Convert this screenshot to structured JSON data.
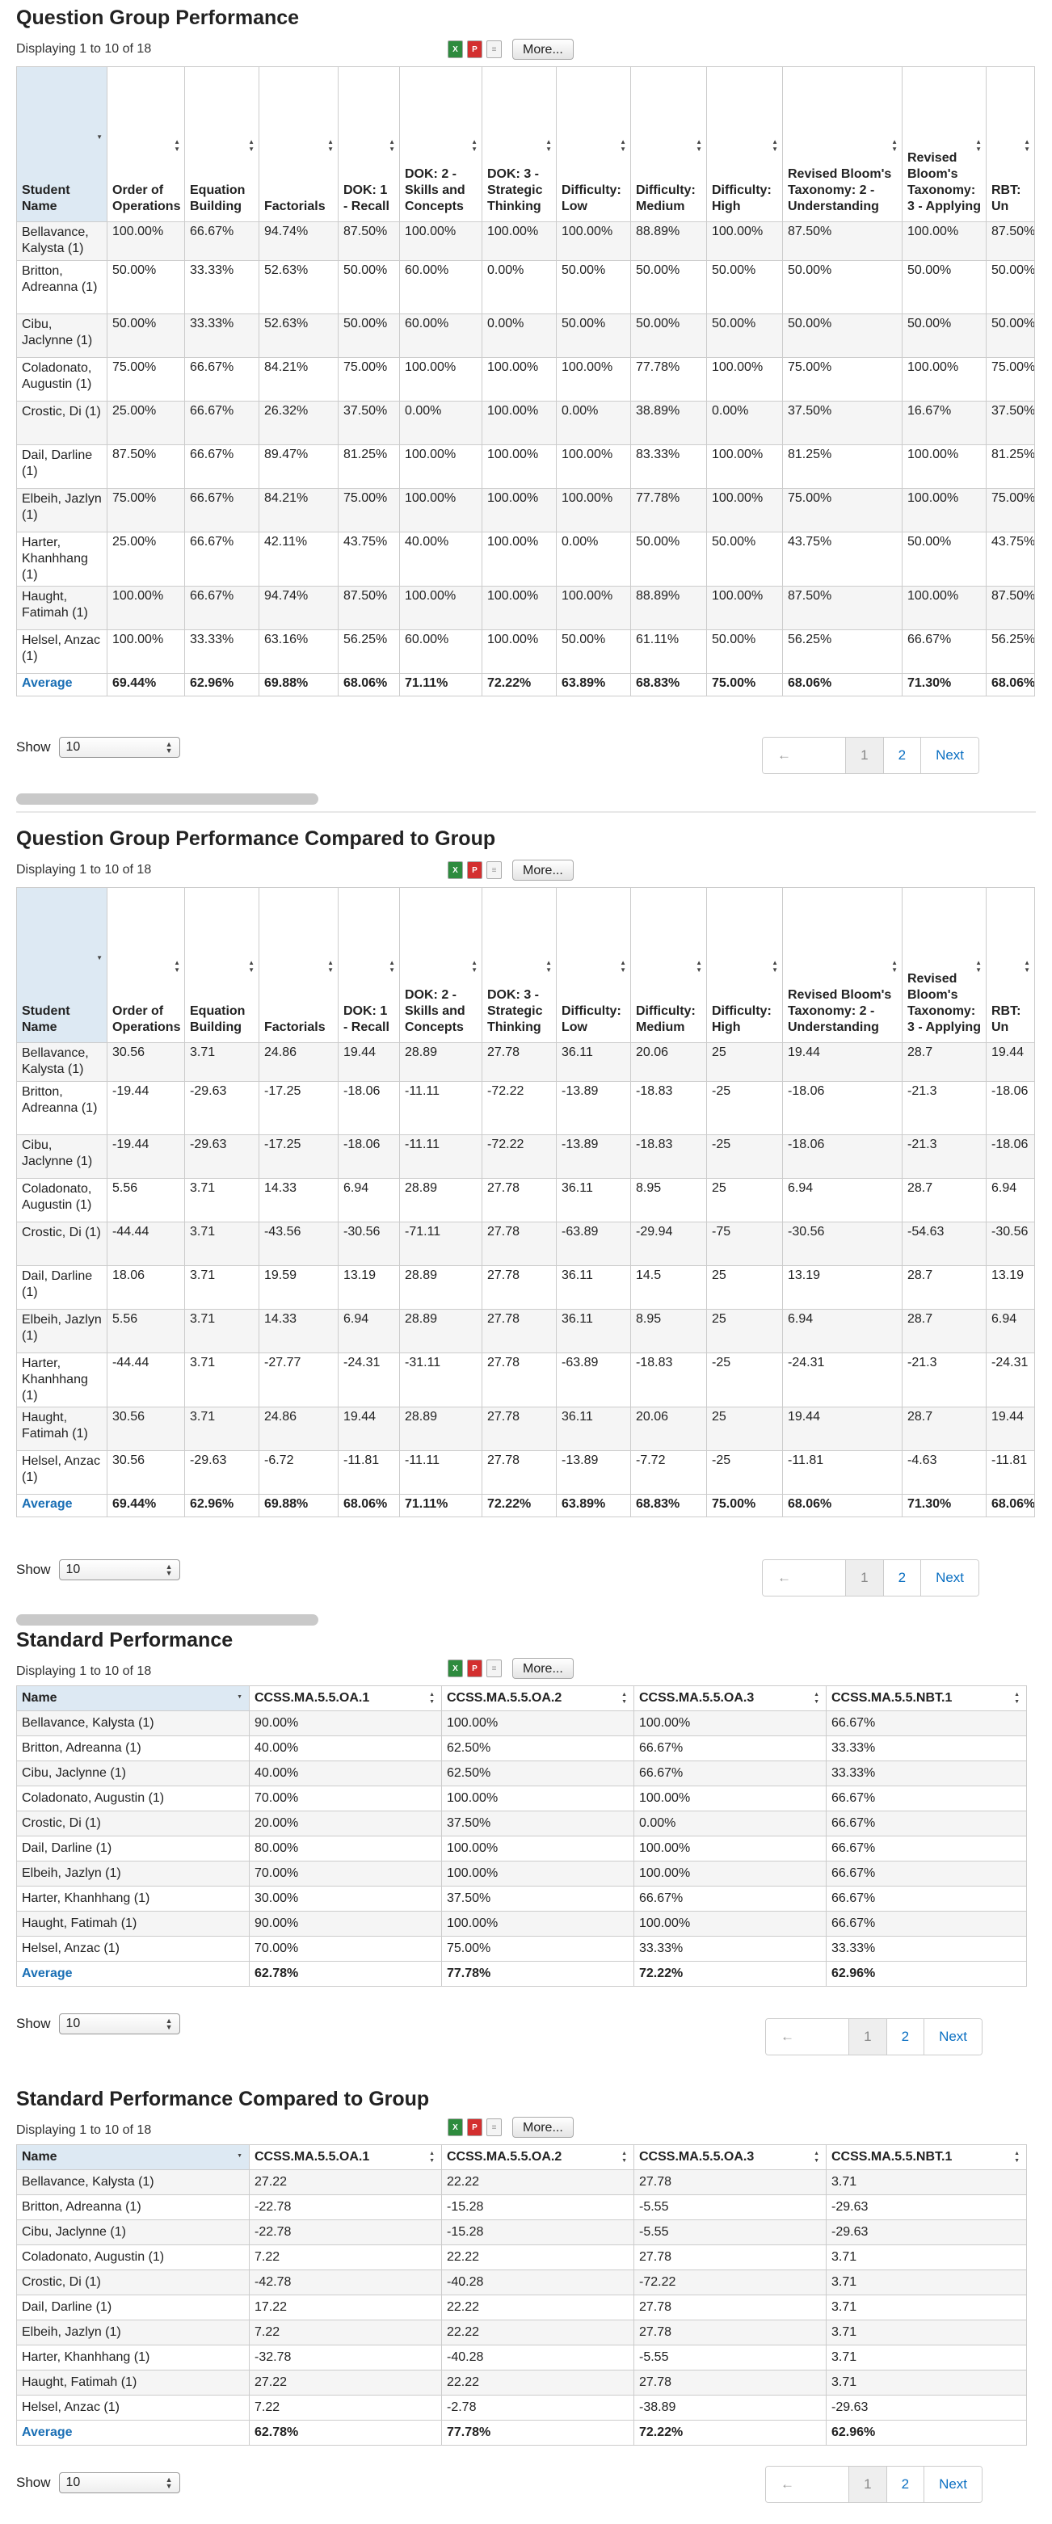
{
  "sections": {
    "qgp": {
      "title": "Question Group Performance",
      "displaying": "Displaying 1 to 10 of 18",
      "more_label": "More...",
      "headers": [
        "Student Name",
        "Order of Operations",
        "Equation Building",
        "Factorials",
        "DOK: 1 - Recall",
        "DOK: 2 - Skills and Concepts",
        "DOK: 3 - Strategic Thinking",
        "Difficulty: Low",
        "Difficulty: Medium",
        "Difficulty: High",
        "Revised Bloom's Taxonomy: 2 - Understanding",
        "Revised Bloom's Taxonomy: 3 - Applying",
        "RBT: Un"
      ],
      "rows": [
        [
          "Bellavance, Kalysta (1)",
          "100.00%",
          "66.67%",
          "94.74%",
          "87.50%",
          "100.00%",
          "100.00%",
          "100.00%",
          "88.89%",
          "100.00%",
          "87.50%",
          "100.00%",
          "87.50%"
        ],
        [
          "Britton, Adreanna (1)",
          "50.00%",
          "33.33%",
          "52.63%",
          "50.00%",
          "60.00%",
          "0.00%",
          "50.00%",
          "50.00%",
          "50.00%",
          "50.00%",
          "50.00%",
          "50.00%"
        ],
        [
          "Cibu, Jaclynne (1)",
          "50.00%",
          "33.33%",
          "52.63%",
          "50.00%",
          "60.00%",
          "0.00%",
          "50.00%",
          "50.00%",
          "50.00%",
          "50.00%",
          "50.00%",
          "50.00%"
        ],
        [
          "Coladonato, Augustin (1)",
          "75.00%",
          "66.67%",
          "84.21%",
          "75.00%",
          "100.00%",
          "100.00%",
          "100.00%",
          "77.78%",
          "100.00%",
          "75.00%",
          "100.00%",
          "75.00%"
        ],
        [
          "Crostic, Di (1)",
          "25.00%",
          "66.67%",
          "26.32%",
          "37.50%",
          "0.00%",
          "100.00%",
          "0.00%",
          "38.89%",
          "0.00%",
          "37.50%",
          "16.67%",
          "37.50%"
        ],
        [
          "Dail, Darline (1)",
          "87.50%",
          "66.67%",
          "89.47%",
          "81.25%",
          "100.00%",
          "100.00%",
          "100.00%",
          "83.33%",
          "100.00%",
          "81.25%",
          "100.00%",
          "81.25%"
        ],
        [
          "Elbeih, Jazlyn (1)",
          "75.00%",
          "66.67%",
          "84.21%",
          "75.00%",
          "100.00%",
          "100.00%",
          "100.00%",
          "77.78%",
          "100.00%",
          "75.00%",
          "100.00%",
          "75.00%"
        ],
        [
          "Harter, Khanhhang (1)",
          "25.00%",
          "66.67%",
          "42.11%",
          "43.75%",
          "40.00%",
          "100.00%",
          "0.00%",
          "50.00%",
          "50.00%",
          "43.75%",
          "50.00%",
          "43.75%"
        ],
        [
          "Haught, Fatimah (1)",
          "100.00%",
          "66.67%",
          "94.74%",
          "87.50%",
          "100.00%",
          "100.00%",
          "100.00%",
          "88.89%",
          "100.00%",
          "87.50%",
          "100.00%",
          "87.50%"
        ],
        [
          "Helsel, Anzac (1)",
          "100.00%",
          "33.33%",
          "63.16%",
          "56.25%",
          "60.00%",
          "100.00%",
          "50.00%",
          "61.11%",
          "50.00%",
          "56.25%",
          "66.67%",
          "56.25%"
        ]
      ],
      "average": [
        "Average",
        "69.44%",
        "62.96%",
        "69.88%",
        "68.06%",
        "71.11%",
        "72.22%",
        "63.89%",
        "68.83%",
        "75.00%",
        "68.06%",
        "71.30%",
        "68.06%"
      ],
      "show_label": "Show",
      "show_value": "10",
      "pager": [
        "← Previous",
        "1",
        "2",
        "Next →"
      ]
    },
    "qgpc": {
      "title": "Question Group Performance Compared to Group",
      "displaying": "Displaying 1 to 10 of 18",
      "more_label": "More...",
      "headers": [
        "Student Name",
        "Order of Operations",
        "Equation Building",
        "Factorials",
        "DOK: 1 - Recall",
        "DOK: 2 - Skills and Concepts",
        "DOK: 3 - Strategic Thinking",
        "Difficulty: Low",
        "Difficulty: Medium",
        "Difficulty: High",
        "Revised Bloom's Taxonomy: 2 - Understanding",
        "Revised Bloom's Taxonomy: 3 - Applying",
        "RBT: Un"
      ],
      "rows": [
        [
          "Bellavance, Kalysta (1)",
          "30.56",
          "3.71",
          "24.86",
          "19.44",
          "28.89",
          "27.78",
          "36.11",
          "20.06",
          "25",
          "19.44",
          "28.7",
          "19.44"
        ],
        [
          "Britton, Adreanna (1)",
          "-19.44",
          "-29.63",
          "-17.25",
          "-18.06",
          "-11.11",
          "-72.22",
          "-13.89",
          "-18.83",
          "-25",
          "-18.06",
          "-21.3",
          "-18.06"
        ],
        [
          "Cibu, Jaclynne (1)",
          "-19.44",
          "-29.63",
          "-17.25",
          "-18.06",
          "-11.11",
          "-72.22",
          "-13.89",
          "-18.83",
          "-25",
          "-18.06",
          "-21.3",
          "-18.06"
        ],
        [
          "Coladonato, Augustin (1)",
          "5.56",
          "3.71",
          "14.33",
          "6.94",
          "28.89",
          "27.78",
          "36.11",
          "8.95",
          "25",
          "6.94",
          "28.7",
          "6.94"
        ],
        [
          "Crostic, Di (1)",
          "-44.44",
          "3.71",
          "-43.56",
          "-30.56",
          "-71.11",
          "27.78",
          "-63.89",
          "-29.94",
          "-75",
          "-30.56",
          "-54.63",
          "-30.56"
        ],
        [
          "Dail, Darline (1)",
          "18.06",
          "3.71",
          "19.59",
          "13.19",
          "28.89",
          "27.78",
          "36.11",
          "14.5",
          "25",
          "13.19",
          "28.7",
          "13.19"
        ],
        [
          "Elbeih, Jazlyn (1)",
          "5.56",
          "3.71",
          "14.33",
          "6.94",
          "28.89",
          "27.78",
          "36.11",
          "8.95",
          "25",
          "6.94",
          "28.7",
          "6.94"
        ],
        [
          "Harter, Khanhhang (1)",
          "-44.44",
          "3.71",
          "-27.77",
          "-24.31",
          "-31.11",
          "27.78",
          "-63.89",
          "-18.83",
          "-25",
          "-24.31",
          "-21.3",
          "-24.31"
        ],
        [
          "Haught, Fatimah (1)",
          "30.56",
          "3.71",
          "24.86",
          "19.44",
          "28.89",
          "27.78",
          "36.11",
          "20.06",
          "25",
          "19.44",
          "28.7",
          "19.44"
        ],
        [
          "Helsel, Anzac (1)",
          "30.56",
          "-29.63",
          "-6.72",
          "-11.81",
          "-11.11",
          "27.78",
          "-13.89",
          "-7.72",
          "-25",
          "-11.81",
          "-4.63",
          "-11.81"
        ]
      ],
      "average": [
        "Average",
        "69.44%",
        "62.96%",
        "69.88%",
        "68.06%",
        "71.11%",
        "72.22%",
        "63.89%",
        "68.83%",
        "75.00%",
        "68.06%",
        "71.30%",
        "68.06%"
      ],
      "show_label": "Show",
      "show_value": "10",
      "pager": [
        "← Previous",
        "1",
        "2",
        "Next →"
      ]
    },
    "sp": {
      "title": "Standard Performance",
      "displaying": "Displaying 1 to 10 of 18",
      "more_label": "More...",
      "headers": [
        "Name",
        "CCSS.MA.5.5.OA.1",
        "CCSS.MA.5.5.OA.2",
        "CCSS.MA.5.5.OA.3",
        "CCSS.MA.5.5.NBT.1"
      ],
      "rows": [
        [
          "Bellavance, Kalysta (1)",
          "90.00%",
          "100.00%",
          "100.00%",
          "66.67%"
        ],
        [
          "Britton, Adreanna (1)",
          "40.00%",
          "62.50%",
          "66.67%",
          "33.33%"
        ],
        [
          "Cibu, Jaclynne (1)",
          "40.00%",
          "62.50%",
          "66.67%",
          "33.33%"
        ],
        [
          "Coladonato, Augustin (1)",
          "70.00%",
          "100.00%",
          "100.00%",
          "66.67%"
        ],
        [
          "Crostic, Di (1)",
          "20.00%",
          "37.50%",
          "0.00%",
          "66.67%"
        ],
        [
          "Dail, Darline (1)",
          "80.00%",
          "100.00%",
          "100.00%",
          "66.67%"
        ],
        [
          "Elbeih, Jazlyn (1)",
          "70.00%",
          "100.00%",
          "100.00%",
          "66.67%"
        ],
        [
          "Harter, Khanhhang (1)",
          "30.00%",
          "37.50%",
          "66.67%",
          "66.67%"
        ],
        [
          "Haught, Fatimah (1)",
          "90.00%",
          "100.00%",
          "100.00%",
          "66.67%"
        ],
        [
          "Helsel, Anzac (1)",
          "70.00%",
          "75.00%",
          "33.33%",
          "33.33%"
        ]
      ],
      "average": [
        "Average",
        "62.78%",
        "77.78%",
        "72.22%",
        "62.96%"
      ],
      "show_label": "Show",
      "show_value": "10",
      "pager": [
        "← Previous",
        "1",
        "2",
        "Next →"
      ]
    },
    "spc": {
      "title": "Standard Performance Compared to Group",
      "displaying": "Displaying 1 to 10 of 18",
      "more_label": "More...",
      "headers": [
        "Name",
        "CCSS.MA.5.5.OA.1",
        "CCSS.MA.5.5.OA.2",
        "CCSS.MA.5.5.OA.3",
        "CCSS.MA.5.5.NBT.1"
      ],
      "rows": [
        [
          "Bellavance, Kalysta (1)",
          "27.22",
          "22.22",
          "27.78",
          "3.71"
        ],
        [
          "Britton, Adreanna (1)",
          "-22.78",
          "-15.28",
          "-5.55",
          "-29.63"
        ],
        [
          "Cibu, Jaclynne (1)",
          "-22.78",
          "-15.28",
          "-5.55",
          "-29.63"
        ],
        [
          "Coladonato, Augustin (1)",
          "7.22",
          "22.22",
          "27.78",
          "3.71"
        ],
        [
          "Crostic, Di (1)",
          "-42.78",
          "-40.28",
          "-72.22",
          "3.71"
        ],
        [
          "Dail, Darline (1)",
          "17.22",
          "22.22",
          "27.78",
          "3.71"
        ],
        [
          "Elbeih, Jazlyn (1)",
          "7.22",
          "22.22",
          "27.78",
          "3.71"
        ],
        [
          "Harter, Khanhhang (1)",
          "-32.78",
          "-40.28",
          "-5.55",
          "3.71"
        ],
        [
          "Haught, Fatimah (1)",
          "27.22",
          "22.22",
          "27.78",
          "3.71"
        ],
        [
          "Helsel, Anzac (1)",
          "7.22",
          "-2.78",
          "-38.89",
          "-29.63"
        ]
      ],
      "average": [
        "Average",
        "62.78%",
        "77.78%",
        "72.22%",
        "62.96%"
      ],
      "show_label": "Show",
      "show_value": "10",
      "pager": [
        "← Previous",
        "1",
        "2",
        "Next →"
      ]
    }
  },
  "export_icons": [
    "excel-icon",
    "pdf-icon",
    "csv-icon"
  ],
  "colors": {
    "link": "#1a6fb5",
    "sorted_header": "#dde9f3"
  }
}
